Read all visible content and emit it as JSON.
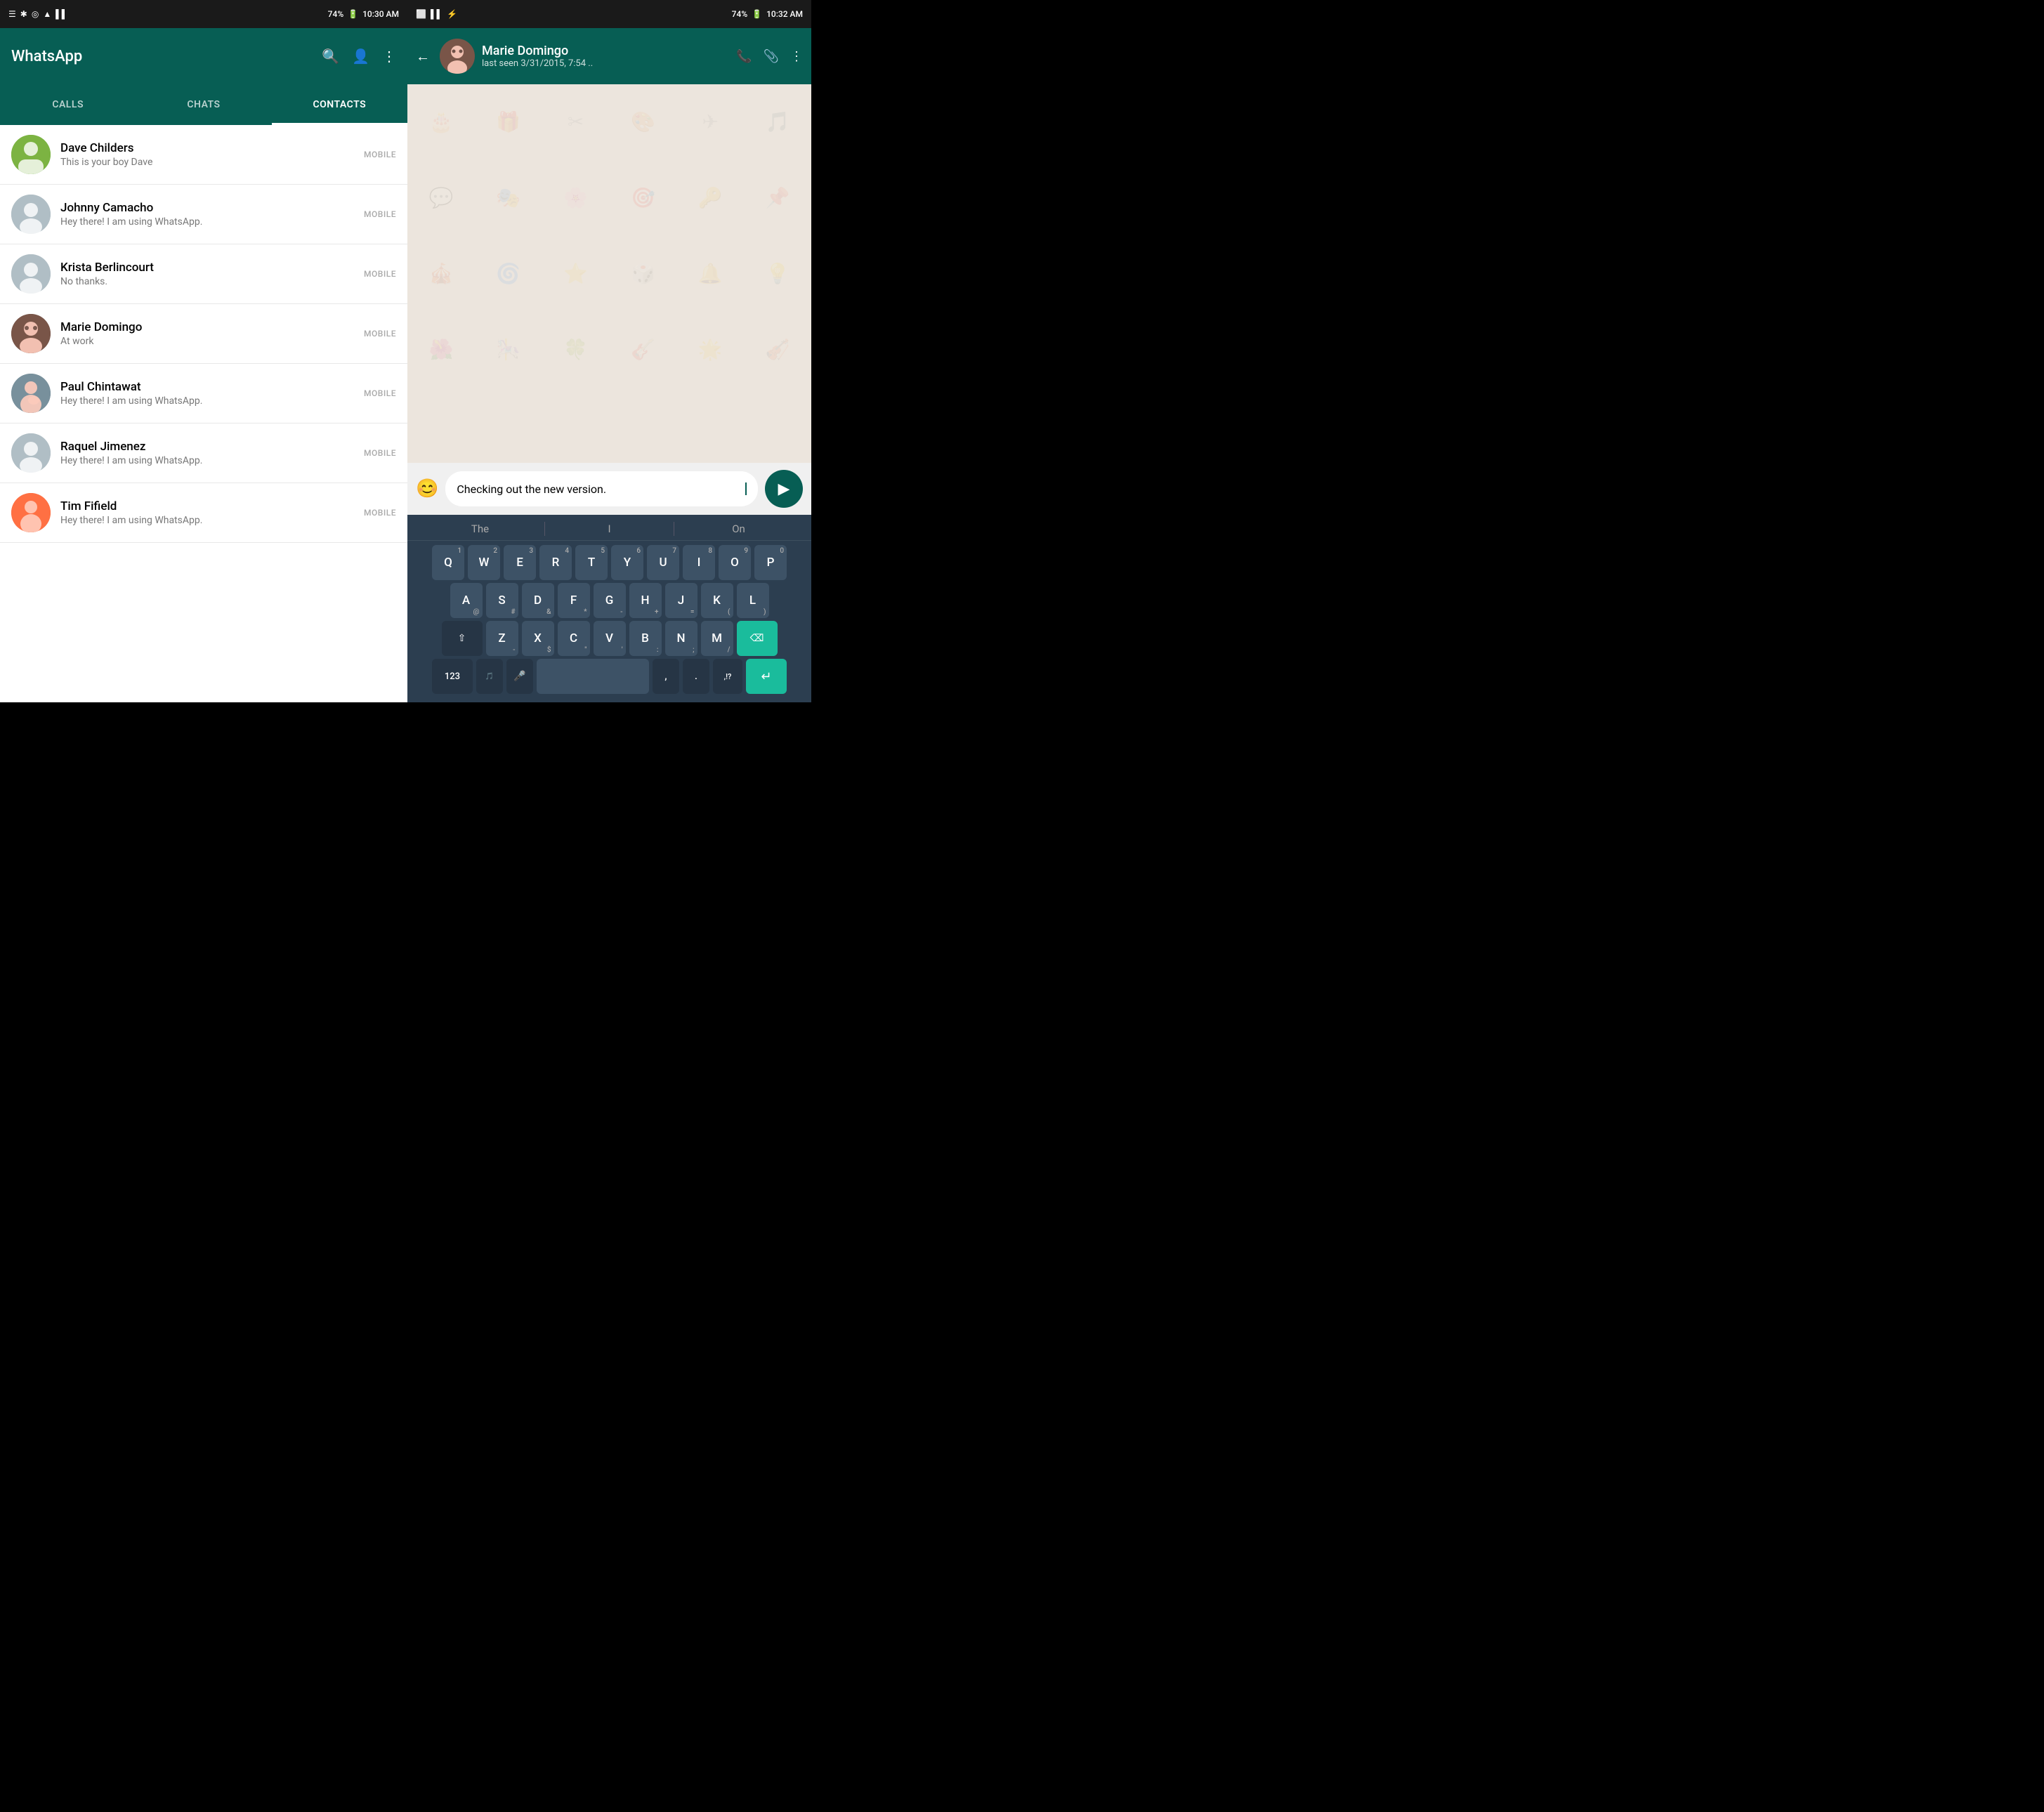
{
  "left": {
    "statusBar": {
      "icons": [
        "☰",
        "↗",
        "✱",
        "◎",
        "☿",
        "▲"
      ],
      "battery": "74%",
      "time": "10:30 AM"
    },
    "header": {
      "title": "WhatsApp",
      "searchIcon": "🔍",
      "addContactIcon": "👤+",
      "menuIcon": "⋮"
    },
    "tabs": [
      {
        "id": "calls",
        "label": "CALLS",
        "active": false
      },
      {
        "id": "chats",
        "label": "CHATS",
        "active": false
      },
      {
        "id": "contacts",
        "label": "CONTACTS",
        "active": true
      }
    ],
    "contacts": [
      {
        "id": "dave-childers",
        "name": "Dave Childers",
        "status": "This is your boy Dave",
        "type": "MOBILE",
        "avatarType": "dave"
      },
      {
        "id": "johnny-camacho",
        "name": "Johnny Camacho",
        "status": "Hey there! I am using WhatsApp.",
        "type": "MOBILE",
        "avatarType": "default"
      },
      {
        "id": "krista-berlincourt",
        "name": "Krista Berlincourt",
        "status": "No thanks.",
        "type": "MOBILE",
        "avatarType": "default"
      },
      {
        "id": "marie-domingo",
        "name": "Marie Domingo",
        "status": "At work",
        "type": "MOBILE",
        "avatarType": "marie"
      },
      {
        "id": "paul-chintawat",
        "name": "Paul Chintawat",
        "status": "Hey there! I am using WhatsApp.",
        "type": "MOBILE",
        "avatarType": "paul"
      },
      {
        "id": "raquel-jimenez",
        "name": "Raquel Jimenez",
        "status": "Hey there! I am using WhatsApp.",
        "type": "MOBILE",
        "avatarType": "default"
      },
      {
        "id": "tim-fifield",
        "name": "Tim Fifield",
        "status": "Hey there! I am using WhatsApp.",
        "type": "MOBILE",
        "avatarType": "tim"
      }
    ]
  },
  "right": {
    "statusBar": {
      "battery": "74%",
      "time": "10:32 AM"
    },
    "chatHeader": {
      "contactName": "Marie Domingo",
      "lastSeen": "last seen 3/31/2015, 7:54 ..",
      "phoneIcon": "📞",
      "attachIcon": "📎",
      "menuIcon": "⋮",
      "backIcon": "←"
    },
    "inputArea": {
      "emojiIcon": "😊",
      "messageText": "Checking out the new version.",
      "sendIcon": "▶"
    },
    "keyboard": {
      "suggestions": [
        "The",
        "I",
        "On"
      ],
      "rows": [
        {
          "keys": [
            {
              "label": "Q",
              "number": "1"
            },
            {
              "label": "W",
              "number": "2"
            },
            {
              "label": "E",
              "number": "3"
            },
            {
              "label": "R",
              "number": "4"
            },
            {
              "label": "T",
              "number": "5"
            },
            {
              "label": "Y",
              "number": "6"
            },
            {
              "label": "U",
              "number": "7"
            },
            {
              "label": "I",
              "number": "8"
            },
            {
              "label": "O",
              "number": "9"
            },
            {
              "label": "P",
              "number": "0"
            }
          ]
        },
        {
          "keys": [
            {
              "label": "A",
              "sub": "@"
            },
            {
              "label": "S",
              "sub": "#"
            },
            {
              "label": "D",
              "sub": "&"
            },
            {
              "label": "F",
              "sub": "*"
            },
            {
              "label": "G",
              "sub": "-"
            },
            {
              "label": "H",
              "sub": "+"
            },
            {
              "label": "J",
              "sub": "="
            },
            {
              "label": "K",
              "sub": "("
            },
            {
              "label": "L",
              "sub": ")"
            }
          ]
        },
        {
          "keys": [
            {
              "label": "⇧",
              "special": true
            },
            {
              "label": "Z",
              "sub": "-"
            },
            {
              "label": "X",
              "sub": "$"
            },
            {
              "label": "C",
              "sub": "\""
            },
            {
              "label": "V",
              "sub": "'"
            },
            {
              "label": "B",
              "sub": ":"
            },
            {
              "label": "N",
              "sub": ";"
            },
            {
              "label": "M",
              "sub": "/"
            },
            {
              "label": "⌫",
              "special": true
            }
          ]
        },
        {
          "keys": [
            {
              "label": "123",
              "special": true
            },
            {
              "label": ","
            },
            {
              "label": " ",
              "type": "space"
            },
            {
              "label": "."
            },
            {
              "label": "↵",
              "type": "action"
            }
          ]
        }
      ],
      "bottomExtras": [
        "🎵",
        "🎤",
        ",!?",
        "☺"
      ]
    }
  }
}
